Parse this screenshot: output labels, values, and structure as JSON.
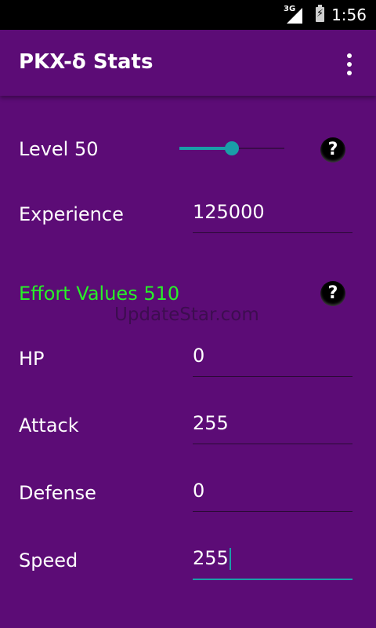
{
  "status_bar": {
    "network": "3G",
    "time": "1:56"
  },
  "app_bar": {
    "title": "PKX-δ Stats"
  },
  "level": {
    "label": "Level 50",
    "slider_fraction": 0.5
  },
  "experience": {
    "label": "Experience",
    "value": "125000"
  },
  "effort_values": {
    "label": "Effort Values 510"
  },
  "help": {
    "glyph": "?"
  },
  "stats": [
    {
      "label": "HP",
      "value": "0"
    },
    {
      "label": "Attack",
      "value": "255"
    },
    {
      "label": "Defense",
      "value": "0"
    },
    {
      "label": "Speed",
      "value": "255"
    }
  ],
  "watermark": "UpdateStar.com",
  "colors": {
    "background": "#5c0c76",
    "accent": "#1a9ea8",
    "ev_header": "#28f028"
  }
}
